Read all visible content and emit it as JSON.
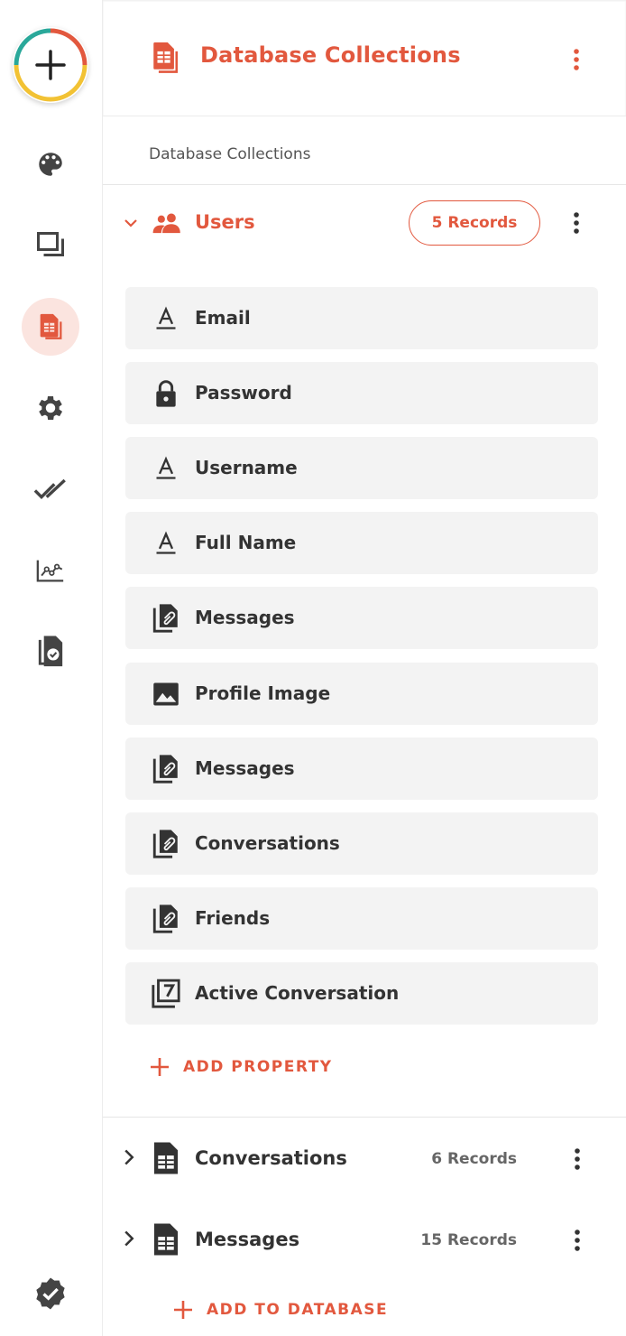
{
  "colors": {
    "accent": "#e2583e",
    "accent_soft": "#fbe4df",
    "icon": "#333333"
  },
  "rail": {
    "items": [
      {
        "icon": "palette-icon"
      },
      {
        "icon": "screens-icon"
      },
      {
        "icon": "database-icon",
        "active": true
      },
      {
        "icon": "gear-icon"
      },
      {
        "icon": "double-check-icon"
      },
      {
        "icon": "analytics-icon"
      },
      {
        "icon": "copy-check-icon"
      }
    ],
    "bottom_icon": "verified-badge-icon"
  },
  "header": {
    "title": "Database Collections",
    "subtitle": "Database Collections"
  },
  "users": {
    "name": "Users",
    "records": "5 Records",
    "properties": [
      {
        "label": "Email",
        "icon": "text-type-icon"
      },
      {
        "label": "Password",
        "icon": "lock-icon"
      },
      {
        "label": "Username",
        "icon": "text-type-icon"
      },
      {
        "label": "Full Name",
        "icon": "text-type-icon"
      },
      {
        "label": "Messages",
        "icon": "relation-icon"
      },
      {
        "label": "Profile Image",
        "icon": "image-icon"
      },
      {
        "label": "Messages",
        "icon": "relation-icon"
      },
      {
        "label": "Conversations",
        "icon": "relation-icon"
      },
      {
        "label": "Friends",
        "icon": "relation-icon"
      },
      {
        "label": "Active Conversation",
        "icon": "number-icon"
      }
    ],
    "add_property": "ADD PROPERTY"
  },
  "collections": [
    {
      "name": "Conversations",
      "records": "6 Records"
    },
    {
      "name": "Messages",
      "records": "15 Records"
    }
  ],
  "add_to_database": "ADD TO DATABASE"
}
